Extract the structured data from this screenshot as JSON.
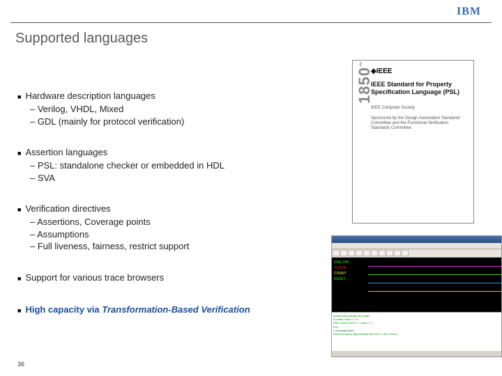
{
  "header": {
    "logo_text": "IBM"
  },
  "title": "Supported languages",
  "bullets": [
    {
      "text": "Hardware description languages",
      "subs": [
        "– Verilog, VHDL, Mixed",
        "– GDL (mainly for protocol verification)"
      ]
    },
    {
      "text": "Assertion languages",
      "subs": [
        "– PSL: standalone checker or embedded in HDL",
        "– SVA"
      ]
    },
    {
      "text": "Verification directives",
      "subs": [
        "– Assertions, Coverage points",
        "– Assumptions",
        "– Full liveness, fairness, restrict support"
      ]
    },
    {
      "text": "Support for various trace browsers",
      "subs": []
    },
    {
      "text_prefix": "High capacity via ",
      "text_italic": "Transformation-Based Verification",
      "highlight": true,
      "subs": []
    }
  ],
  "page_number": "36",
  "ieee": {
    "side": "1850",
    "tm": "™",
    "logo": "◈IEEE",
    "title": "IEEE Standard for Property Specification Language (PSL)",
    "society": "IEEE Computer Society",
    "sponsor": "Sponsored by the Design Automation Standards Committee and the Functional Verification Standards Committee"
  },
  "waveform": {
    "signals": [
      "ENA_HW",
      "CLOCK",
      "COUNT",
      "RESET"
    ],
    "code_lines": [
      "always @(posedge clk) begin",
      "  if (reset) count <= 0;",
      "  else if (ena) count <= count + 1;",
      "end",
      "// coverage point",
      "assert property (@(posedge clk) ena |-> ##1 count);"
    ]
  }
}
